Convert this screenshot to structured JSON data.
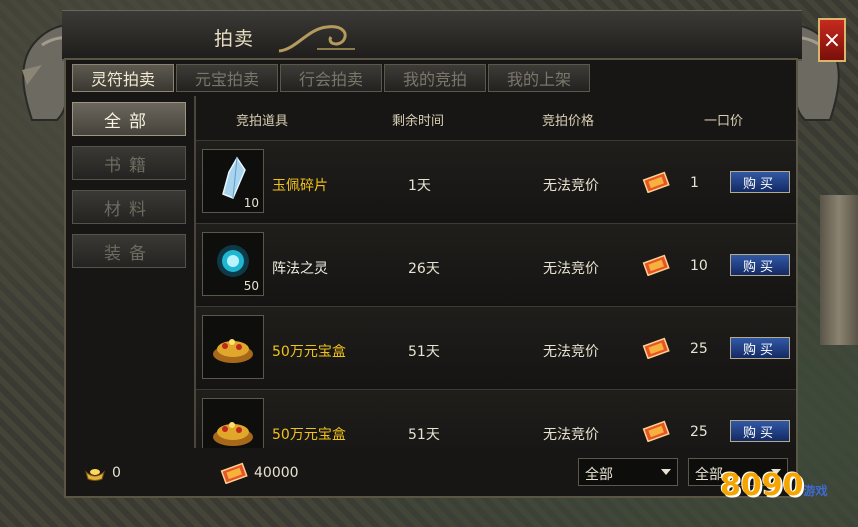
{
  "window": {
    "title": "拍卖",
    "close_label": "×"
  },
  "tabs": [
    {
      "label": "灵符拍卖",
      "active": true
    },
    {
      "label": "元宝拍卖",
      "active": false
    },
    {
      "label": "行会拍卖",
      "active": false
    },
    {
      "label": "我的竞拍",
      "active": false
    },
    {
      "label": "我的上架",
      "active": false
    }
  ],
  "categories": [
    {
      "label": "全部",
      "active": true
    },
    {
      "label": "书籍",
      "active": false
    },
    {
      "label": "材料",
      "active": false
    },
    {
      "label": "装备",
      "active": false
    }
  ],
  "columns": {
    "item": "竞拍道具",
    "time": "剩余时间",
    "bid": "竞拍价格",
    "buyout": "一口价"
  },
  "rows": [
    {
      "name": "玉佩碎片",
      "name_color": "#f2c21b",
      "qty": "10",
      "icon": "crystal-shard-icon",
      "time": "1天",
      "bid": "无法竞价",
      "price": "1",
      "buy_label": "购买"
    },
    {
      "name": "阵法之灵",
      "name_color": "#f0ece0",
      "qty": "50",
      "icon": "spirit-orb-icon",
      "time": "26天",
      "bid": "无法竞价",
      "price": "10",
      "buy_label": "购买"
    },
    {
      "name": "50万元宝盒",
      "name_color": "#f2c21b",
      "qty": "",
      "icon": "treasure-pile-icon",
      "time": "51天",
      "bid": "无法竞价",
      "price": "25",
      "buy_label": "购买"
    },
    {
      "name": "50万元宝盒",
      "name_color": "#f2c21b",
      "qty": "",
      "icon": "treasure-pile-icon",
      "time": "51天",
      "bid": "无法竞价",
      "price": "25",
      "buy_label": "购买"
    }
  ],
  "footer": {
    "gold": "0",
    "coupons": "40000",
    "filter1": "全部",
    "filter2": "全部"
  },
  "watermark": {
    "main": "8090",
    "sub": "游戏"
  }
}
